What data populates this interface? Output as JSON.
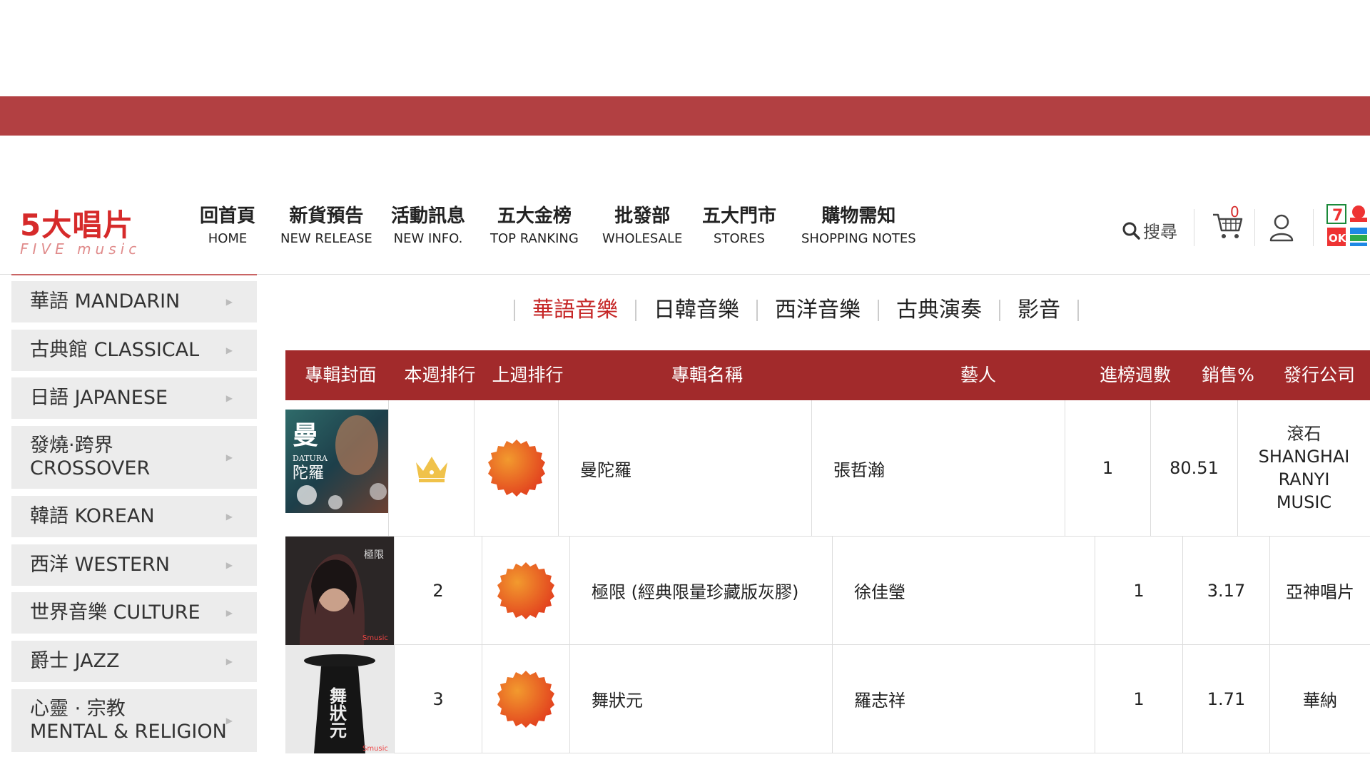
{
  "logo": {
    "main": "5大唱片",
    "sub": "FIVE music"
  },
  "nav": [
    {
      "zh": "回首頁",
      "en": "HOME"
    },
    {
      "zh": "新貨預告",
      "en": "NEW RELEASE"
    },
    {
      "zh": "活動訊息",
      "en": "NEW INFO."
    },
    {
      "zh": "五大金榜",
      "en": "TOP RANKING"
    },
    {
      "zh": "批發部",
      "en": "WHOLESALE"
    },
    {
      "zh": "五大門市",
      "en": "STORES"
    },
    {
      "zh": "購物需知",
      "en": "SHOPPING NOTES"
    }
  ],
  "tools": {
    "search_label": "搜尋",
    "cart_count": "0"
  },
  "sidebar": [
    {
      "label": "華語 MANDARIN"
    },
    {
      "label": "古典館 CLASSICAL"
    },
    {
      "label": "日語 JAPANESE"
    },
    {
      "label": "發燒‧跨界\nCROSSOVER"
    },
    {
      "label": "韓語 KOREAN"
    },
    {
      "label": "西洋 WESTERN"
    },
    {
      "label": "世界音樂 CULTURE"
    },
    {
      "label": "爵士 JAZZ"
    },
    {
      "label": "心靈 · 宗教\nMENTAL & RELIGION"
    }
  ],
  "category_tabs": [
    {
      "label": "華語音樂",
      "active": true
    },
    {
      "label": "日韓音樂",
      "active": false
    },
    {
      "label": "西洋音樂",
      "active": false
    },
    {
      "label": "古典演奏",
      "active": false
    },
    {
      "label": "影音",
      "active": false
    }
  ],
  "table": {
    "headers": [
      "專輯封面",
      "本週排行",
      "上週排行",
      "專輯名稱",
      "藝人",
      "進榜週數",
      "銷售%",
      "發行公司"
    ],
    "rows": [
      {
        "rank": "",
        "rank_icon": "crown-icon",
        "last_week_icon": "new-badge-icon",
        "album": "曼陀羅",
        "artist": "張哲瀚",
        "weeks": "1",
        "sales": "80.51",
        "label": "滾石\nSHANGHAI\nRANYI\nMUSIC",
        "cover_text": "曼 DATURA 陀羅"
      },
      {
        "rank": "2",
        "rank_icon": "",
        "last_week_icon": "new-badge-icon",
        "album": "極限 (經典限量珍藏版灰膠)",
        "artist": "徐佳瑩",
        "weeks": "1",
        "sales": "3.17",
        "label": "亞神唱片",
        "cover_text": "極限"
      },
      {
        "rank": "3",
        "rank_icon": "",
        "last_week_icon": "new-badge-icon",
        "album": "舞狀元",
        "artist": "羅志祥",
        "weeks": "1",
        "sales": "1.71",
        "label": "華納",
        "cover_text": "舞狀元"
      }
    ]
  },
  "colors": {
    "brand": "#d62a2a",
    "band": "#b24042",
    "header_row": "#a22a2b",
    "active_tab": "#c62828"
  }
}
